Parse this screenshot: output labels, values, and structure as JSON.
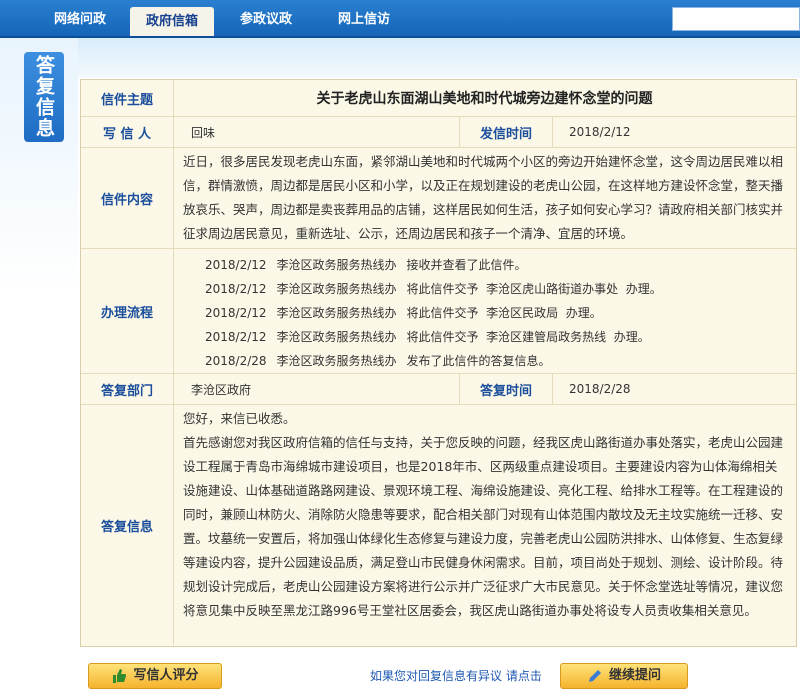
{
  "nav": {
    "tabs": [
      "网络问政",
      "政府信箱",
      "参政议政",
      "网上信访"
    ],
    "active_index": 1
  },
  "side_title": "答复信息",
  "letter": {
    "subject_label": "信件主题",
    "subject": "关于老虎山东面湖山美地和时代城旁边建怀念堂的问题",
    "writer_label": "写 信 人",
    "writer": "回味",
    "send_time_label": "发信时间",
    "send_time": "2018/2/12",
    "content_label": "信件内容",
    "content": "近日，很多居民发现老虎山东面，紧邻湖山美地和时代城两个小区的旁边开始建怀念堂，这令周边居民难以相信，群情激愤，周边都是居民小区和小学，以及正在规划建设的老虎山公园，在这样地方建设怀念堂，整天播放哀乐、哭声，周边都是卖丧葬用品的店铺，这样居民如何生活，孩子如何安心学习？请政府相关部门核实并征求周边居民意见，重新选址、公示，还周边居民和孩子一个清净、宜居的环境。"
  },
  "process": {
    "label": "办理流程",
    "items": [
      {
        "date": "2018/2/12",
        "org": "李沧区政务服务热线办",
        "action": "接收并查看了此信件。"
      },
      {
        "date": "2018/2/12",
        "org": "李沧区政务服务热线办",
        "action": "将此信件交予  李沧区虎山路街道办事处  办理。"
      },
      {
        "date": "2018/2/12",
        "org": "李沧区政务服务热线办",
        "action": "将此信件交予  李沧区民政局  办理。"
      },
      {
        "date": "2018/2/12",
        "org": "李沧区政务服务热线办",
        "action": "将此信件交予  李沧区建管局政务热线  办理。"
      },
      {
        "date": "2018/2/28",
        "org": "李沧区政务服务热线办",
        "action": "发布了此信件的答复信息。"
      }
    ]
  },
  "reply": {
    "dept_label": "答复部门",
    "dept": "李沧区政府",
    "time_label": "答复时间",
    "time": "2018/2/28",
    "info_label": "答复信息",
    "greeting": "您好，来信已收悉。",
    "body": "首先感谢您对我区政府信箱的信任与支持，关于您反映的问题，经我区虎山路街道办事处落实，老虎山公园建设工程属于青岛市海绵城市建设项目，也是2018年市、区两级重点建设项目。主要建设内容为山体海绵相关设施建设、山体基础道路路网建设、景观环境工程、海绵设施建设、亮化工程、给排水工程等。在工程建设的同时，兼顾山林防火、消除防火隐患等要求，配合相关部门对现有山体范围内散坟及无主坟实施统一迁移、安置。坟墓统一安置后，将加强山体绿化生态修复与建设力度，完善老虎山公园防洪排水、山体修复、生态复绿等建设内容，提升公园建设品质，满足登山市民健身休闲需求。目前，项目尚处于规划、测绘、设计阶段。待规划设计完成后，老虎山公园建设方案将进行公示并广泛征求广大市民意见。关于怀念堂选址等情况，建议您将意见集中反映至黑龙江路996号王堂社区居委会，我区虎山路街道办事处将设专人员责收集相关意见。"
  },
  "footer": {
    "rate_button": "写信人评分",
    "objection_text": "如果您对回复信息有异议 请点击",
    "continue_button": "继续提问"
  }
}
